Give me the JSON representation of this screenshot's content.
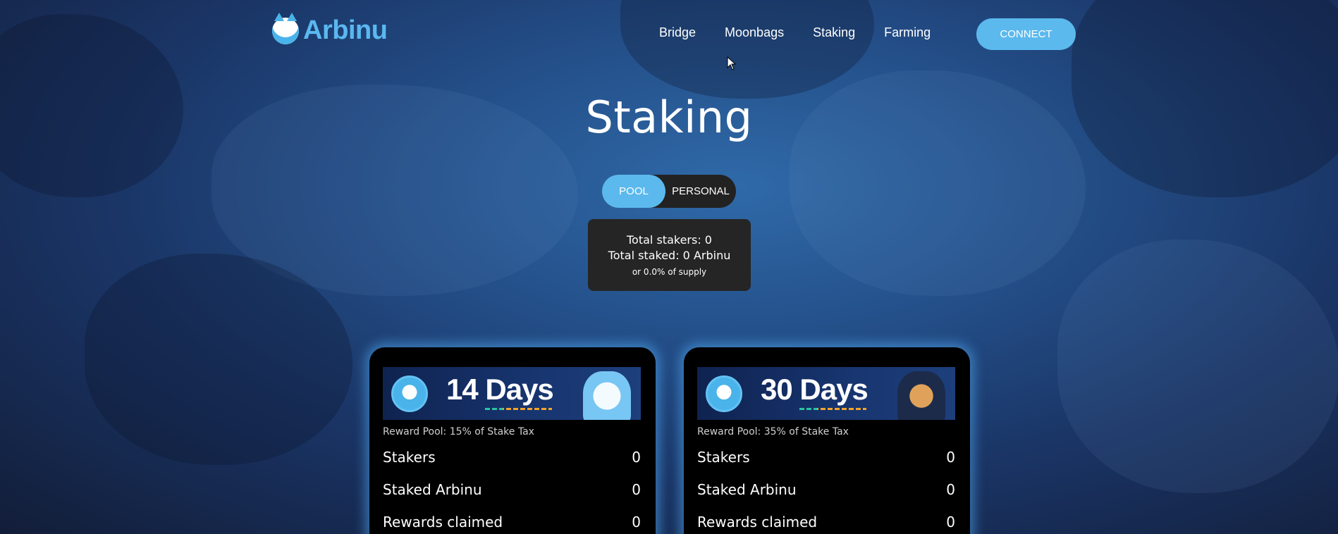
{
  "brand": {
    "name": "Arbinu",
    "accent": "#5bb9ee"
  },
  "nav": {
    "items": [
      {
        "label": "Bridge"
      },
      {
        "label": "Moonbags"
      },
      {
        "label": "Staking"
      },
      {
        "label": "Farming"
      }
    ],
    "connect_label": "CONNECT"
  },
  "page": {
    "title": "Staking"
  },
  "toggle": {
    "pool_label": "POOL",
    "personal_label": "PERSONAL",
    "selected": "POOL"
  },
  "stats": {
    "total_stakers": "Total stakers: 0",
    "total_staked": "Total staked: 0 Arbinu",
    "supply": "or 0.0% of supply"
  },
  "pools": [
    {
      "banner_title": "14 Days",
      "reward_pool": "Reward Pool: 15% of Stake Tax",
      "rows": [
        {
          "label": "Stakers",
          "value": "0"
        },
        {
          "label": "Staked Arbinu",
          "value": "0"
        },
        {
          "label": "Rewards claimed",
          "value": "0"
        }
      ]
    },
    {
      "banner_title": "30 Days",
      "reward_pool": "Reward Pool: 35% of Stake Tax",
      "rows": [
        {
          "label": "Stakers",
          "value": "0"
        },
        {
          "label": "Staked Arbinu",
          "value": "0"
        },
        {
          "label": "Rewards claimed",
          "value": "0"
        }
      ]
    }
  ]
}
